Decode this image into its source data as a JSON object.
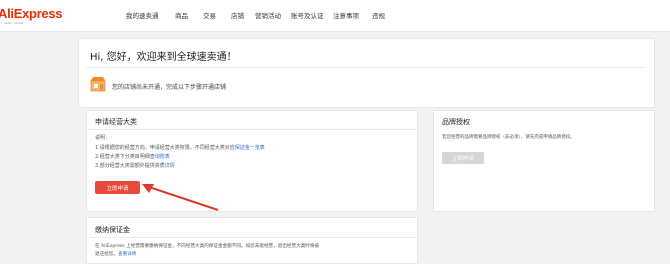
{
  "header": {
    "logo": "AliExpress",
    "logo_sub": "Seller Center",
    "nav": [
      {
        "label": "我的速卖通"
      },
      {
        "label": "商品"
      },
      {
        "label": "交易"
      },
      {
        "label": "店铺"
      },
      {
        "label": "营销活动"
      },
      {
        "label": "账号及认证"
      },
      {
        "label": "注意事项"
      },
      {
        "label": "违规"
      }
    ]
  },
  "welcome": {
    "greeting": "Hi, 您好，欢迎来到全球速卖通！",
    "notice": "您的店铺尚未开通，完成以下步骤开通店铺"
  },
  "apply_category": {
    "title": "申请经营大类",
    "desc_title": "说明：",
    "line1_text": "1.请根据您的经营方向，申请经营大类权限。不同经营大类对应",
    "line1_link": "保证金一览表",
    "line2_text": "2.经营大类下分类目明细查",
    "line2_link": "询附表",
    "line3_text": "3.部分经营大类需额外提供资质",
    "line3_link": "详情",
    "apply_button": "立即申请"
  },
  "brand_auth": {
    "title": "品牌授权",
    "desc": "若您经营的品牌需要品牌授权（非必须），请先完成申请品牌授权。",
    "button": "立即申请"
  },
  "deposit": {
    "title": "缴纳保证金",
    "desc": "在 AliExpress 上经营需要缴纳保证金，不同经营大类的保证金金额不同。如您未能经营，退出经营大类时将被",
    "desc2_text": "退还给您。",
    "desc2_link": "查看详情"
  },
  "colors": {
    "brand": "#e62e04",
    "primary_button": "#e8493a",
    "link": "#2d6ec8",
    "arrow": "#e03b2c"
  }
}
